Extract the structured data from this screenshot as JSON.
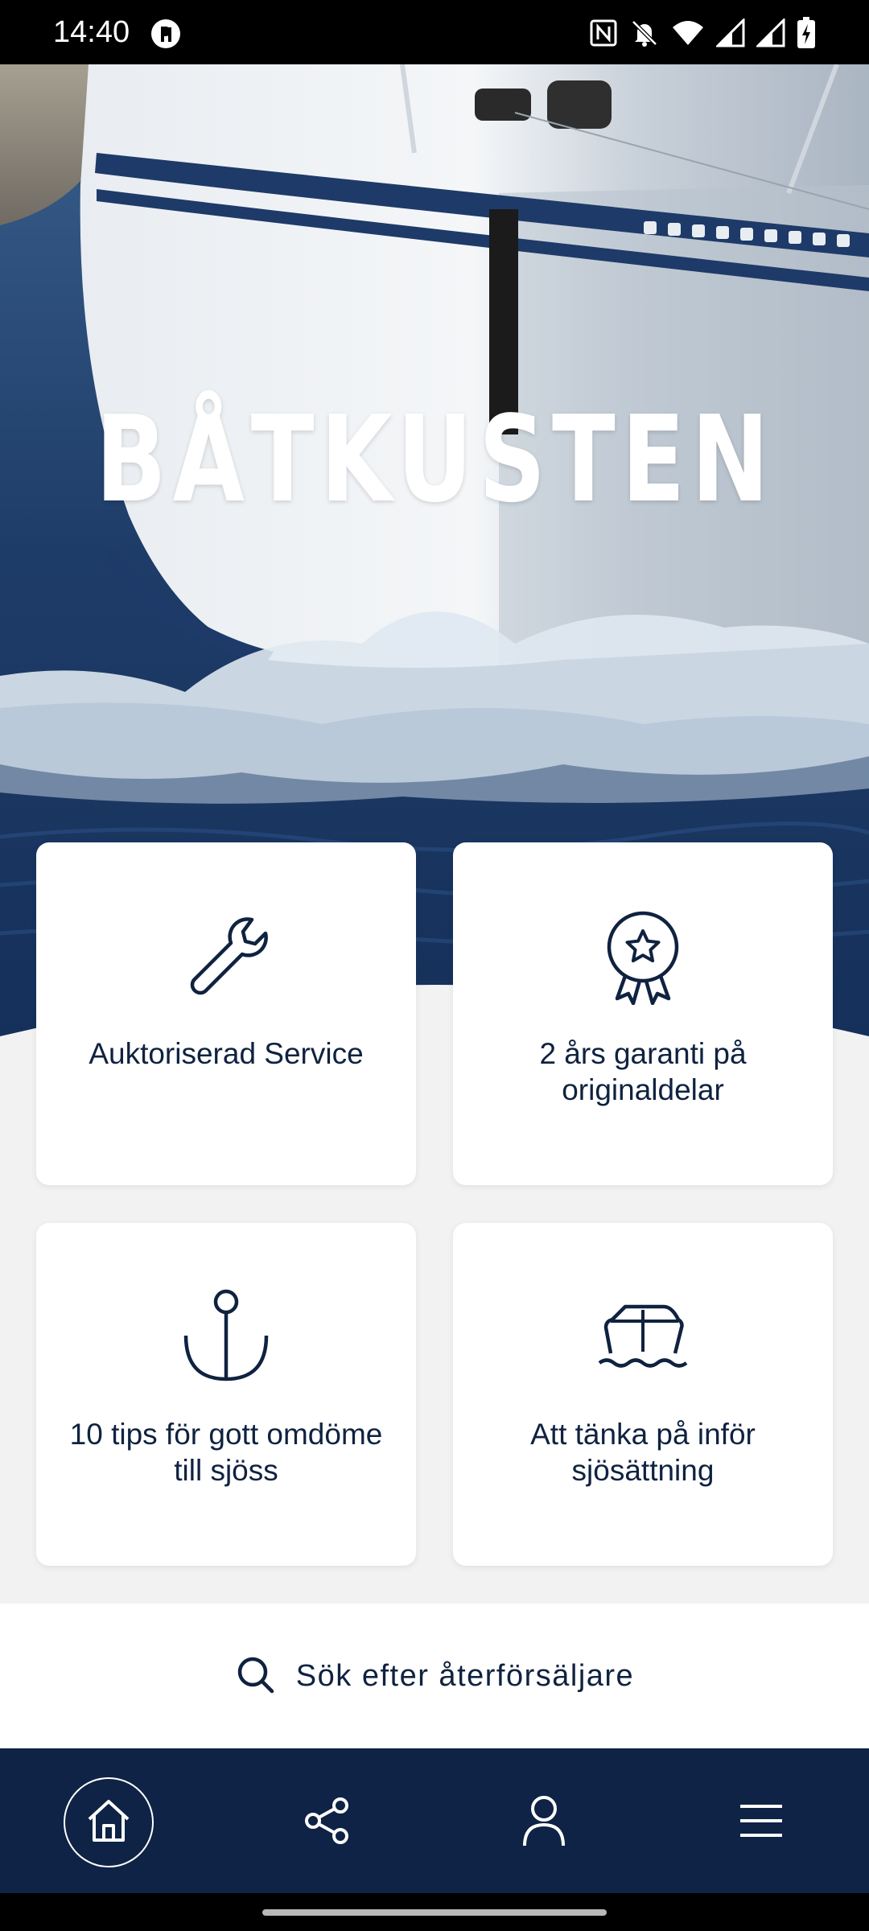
{
  "status_bar": {
    "time": "14:40",
    "icons": [
      "app-notification-icon",
      "nfc-icon",
      "notifications-off-icon",
      "wifi-icon",
      "signal-1-icon",
      "signal-2-icon",
      "battery-charging-icon"
    ]
  },
  "hero": {
    "title": "BÅTKUSTEN"
  },
  "cards": [
    {
      "label": "Auktoriserad Service",
      "icon": "wrench-icon"
    },
    {
      "label": "2 års garanti på originaldelar",
      "icon": "award-badge-icon"
    },
    {
      "label": "10 tips för gott omdöme till sjöss",
      "icon": "anchor-icon"
    },
    {
      "label": "Att tänka på inför sjösättning",
      "icon": "boat-icon"
    }
  ],
  "search": {
    "label": "Sök efter återförsäljare",
    "icon": "search-icon"
  },
  "bottom_nav": {
    "items": [
      {
        "name": "home",
        "icon": "home-icon",
        "active": true
      },
      {
        "name": "share",
        "icon": "share-icon",
        "active": false
      },
      {
        "name": "profile",
        "icon": "person-icon",
        "active": false
      },
      {
        "name": "menu",
        "icon": "hamburger-menu-icon",
        "active": false
      }
    ]
  },
  "colors": {
    "brand_navy": "#0e2345",
    "text_navy": "#0f2240",
    "card_bg": "#ffffff",
    "page_bg": "#f2f2f2"
  }
}
